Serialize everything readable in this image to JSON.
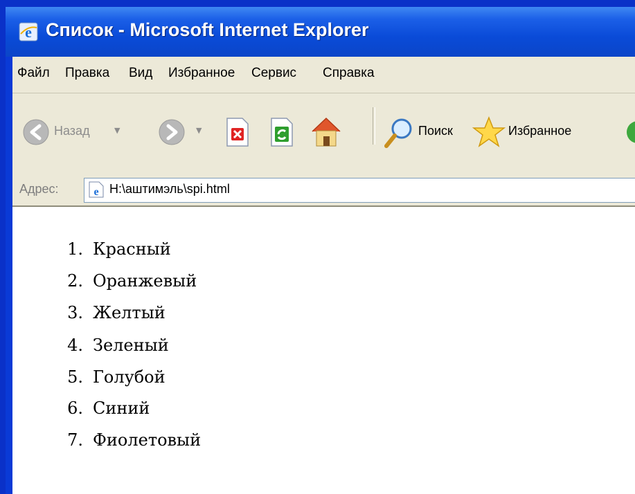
{
  "window": {
    "title": "Список - Microsoft Internet Explorer"
  },
  "menubar": {
    "items": [
      "Файл",
      "Правка",
      "Вид",
      "Избранное",
      "Сервис",
      "Справка"
    ]
  },
  "toolbar": {
    "back_label": "Назад",
    "search_label": "Поиск",
    "favorites_label": "Избранное"
  },
  "addressbar": {
    "label": "Адрес:",
    "value": "H:\\аштимэль\\spi.html"
  },
  "content": {
    "list": [
      {
        "number": "1.",
        "text": "Красный"
      },
      {
        "number": "2.",
        "text": "Оранжевый"
      },
      {
        "number": "3.",
        "text": "Желтый"
      },
      {
        "number": "4.",
        "text": "Зеленый"
      },
      {
        "number": "5.",
        "text": "Голубой"
      },
      {
        "number": "6.",
        "text": "Синий"
      },
      {
        "number": "7.",
        "text": "Фиолетовый"
      }
    ]
  },
  "icons": {
    "window": "ie-logo-icon",
    "back": "back-arrow-icon",
    "forward": "forward-arrow-icon",
    "stop": "stop-icon",
    "refresh": "refresh-icon",
    "home": "home-icon",
    "search": "magnifier-icon",
    "favorites": "star-icon",
    "media": "media-icon",
    "address": "ie-page-icon"
  },
  "colors": {
    "titlebar": "#0a4bd8",
    "chrome": "#ece9d8",
    "background": "#0a31c8"
  }
}
